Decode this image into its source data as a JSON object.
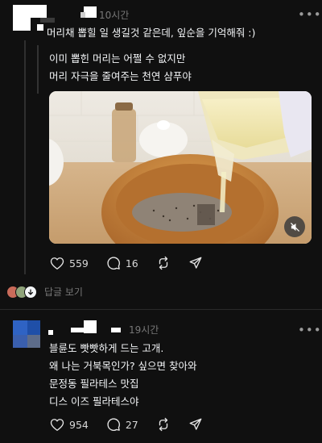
{
  "post1": {
    "time": "10시간",
    "more_icon": "more-horizontal-icon",
    "text": "머리채 뽑힐 일 생길것 같은데, 잎순을 기억해줘 :)",
    "quote_lines": [
      "이미 뽑힌 머리는 어쩔 수 없지만",
      "머리 자극을 줄여주는 천연 샴푸야"
    ],
    "media": {
      "mute_icon": "speaker-muted-icon"
    },
    "actions": {
      "likes": "559",
      "comments": "16"
    },
    "replies_label": "답글 보기"
  },
  "post2": {
    "time": "19시간",
    "more_icon": "more-horizontal-icon",
    "lines": [
      "블륜도 빳빳하게 드는 고개.",
      "왜 나는 거북목인가? 싶으면 찾아와",
      "문정동 필라테스 맛집",
      "디스 이즈 필라테스야"
    ],
    "actions": {
      "likes": "954",
      "comments": "27"
    }
  },
  "colors": {
    "background": "#101010",
    "text": "#f3f5f7",
    "muted": "#777777",
    "censor_blue": "#1f5bbf"
  }
}
